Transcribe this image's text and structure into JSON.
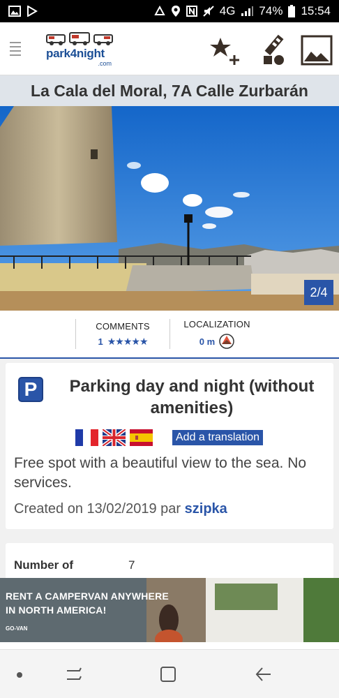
{
  "status_bar": {
    "icons": [
      "image-icon",
      "play-store-icon",
      "recycle-icon",
      "location-icon",
      "nfc-icon",
      "mute-icon",
      "signal-icon",
      "battery-icon"
    ],
    "network": "4G",
    "battery": "74%",
    "time": "15:54"
  },
  "header": {
    "logo_text": "park4night",
    "logo_suffix": ".com",
    "icons": [
      "menu-icon",
      "add-favorite-icon",
      "directions-icon",
      "gallery-icon"
    ]
  },
  "place": {
    "title": "La Cala del Moral, 7A Calle Zurbarán",
    "photo_counter": "2/4"
  },
  "stats": {
    "comments_label": "COMMENTS",
    "comments_count": "1",
    "comments_stars": "★★★★★",
    "localization_label": "LOCALIZATION",
    "localization_value": "0 m"
  },
  "details": {
    "badge": "P",
    "type_title": "Parking day and night (without amenities)",
    "languages": [
      "fr",
      "gb",
      "es"
    ],
    "translate_label": "Add a translation",
    "description": "Free spot with a beautiful view to the sea. No services.",
    "created_prefix": "Created on 13/02/2019 par",
    "author": "szipka"
  },
  "info": {
    "label": "Number of",
    "value": "7"
  },
  "ad": {
    "line1": "RENT A CAMPERVAN ANYWHERE",
    "line2": "IN NORTH AMERICA!",
    "brand": "GO-VAN"
  },
  "colors": {
    "accent": "#2a55a8",
    "title_bar": "#dfe4ea",
    "text": "#333333"
  }
}
